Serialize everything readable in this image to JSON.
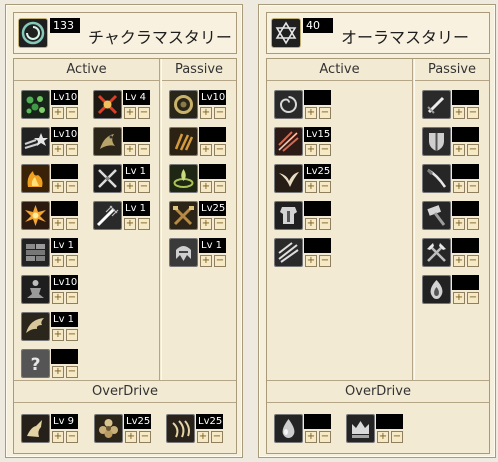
{
  "colors": {
    "panel_bg": "#f6efdc",
    "border": "#a99b7a",
    "level_bg": "#000000",
    "button_bg": "#f5e9c6"
  },
  "left": {
    "title": "チャクラマスタリー",
    "level": "133",
    "icon": "chakra-swirl-icon",
    "active_header": "Active",
    "passive_header": "Passive",
    "overdrive_header": "OverDrive",
    "active": [
      {
        "level": "Lv10",
        "icon": "green-orbs-icon"
      },
      {
        "level": "Lv 4",
        "icon": "red-x-star-icon"
      },
      {
        "level": "Lv10",
        "icon": "star-dash-icon"
      },
      {
        "level": "",
        "icon": "dragon-claw-icon"
      },
      {
        "level": "",
        "icon": "fire-fist-icon"
      },
      {
        "level": "Lv 1",
        "icon": "crossed-blades-icon"
      },
      {
        "level": "",
        "icon": "explosion-icon"
      },
      {
        "level": "Lv 1",
        "icon": "sword-flash-icon"
      },
      {
        "level": "Lv 1",
        "icon": "wall-icon"
      },
      {
        "level": "Lv10",
        "icon": "meditation-icon"
      },
      {
        "level": "Lv 1",
        "icon": "wing-icon"
      },
      {
        "level": "",
        "icon": "question-mark-icon"
      }
    ],
    "passive": [
      {
        "level": "Lv10",
        "icon": "gold-ring-icon"
      },
      {
        "level": "",
        "icon": "gold-claw-icon"
      },
      {
        "level": "",
        "icon": "green-aura-icon"
      },
      {
        "level": "Lv25",
        "icon": "crossed-weapons-icon"
      },
      {
        "level": "Lv 1",
        "icon": "helm-icon"
      }
    ],
    "overdrive": [
      {
        "level": "Lv 9",
        "icon": "beast-kick-icon"
      },
      {
        "level": "Lv25",
        "icon": "flower-burst-icon"
      },
      {
        "level": "Lv25",
        "icon": "claw-strike-icon"
      }
    ]
  },
  "right": {
    "title": "オーラマスタリー",
    "level": "40",
    "icon": "hexagram-icon",
    "active_header": "Active",
    "passive_header": "Passive",
    "overdrive_header": "OverDrive",
    "active": [
      {
        "level": "",
        "icon": "vortex-icon"
      },
      {
        "level": "Lv15",
        "icon": "red-slash-icon"
      },
      {
        "level": "Lv25",
        "icon": "bird-icon"
      },
      {
        "level": "",
        "icon": "armor-icon"
      },
      {
        "level": "",
        "icon": "triple-slash-icon"
      }
    ],
    "passive": [
      {
        "level": "",
        "icon": "sword-icon"
      },
      {
        "level": "",
        "icon": "shield-icon"
      },
      {
        "level": "",
        "icon": "katana-icon"
      },
      {
        "level": "",
        "icon": "hammer-icon"
      },
      {
        "level": "",
        "icon": "crossed-axes-icon"
      },
      {
        "level": "",
        "icon": "flame-icon"
      }
    ],
    "overdrive": [
      {
        "level": "",
        "icon": "droplet-icon"
      },
      {
        "level": "",
        "icon": "crown-icon"
      }
    ]
  },
  "buttons": {
    "plus": "+",
    "minus": "−"
  }
}
